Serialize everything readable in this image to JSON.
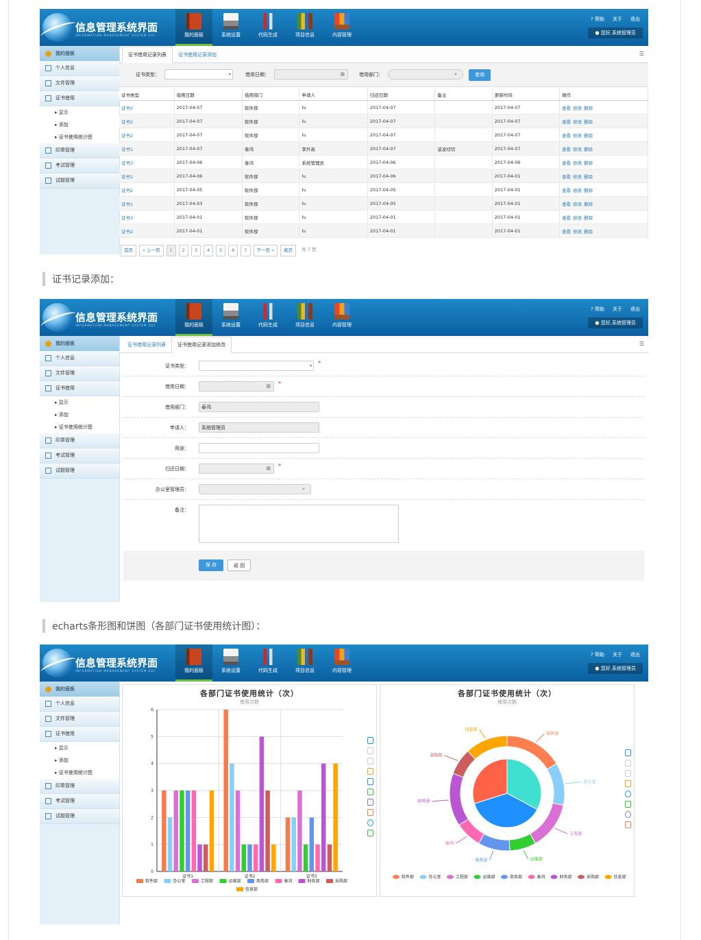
{
  "app": {
    "title": "信息管理系统界面",
    "subtitle": "INFORMATION MANAGEMENT SYSTEM GUI",
    "nav": [
      "我的面板",
      "系统设置",
      "代码生成",
      "项目信息",
      "内容管理"
    ],
    "top_links": [
      "帮助",
      "关于",
      "退出"
    ],
    "user": "您好,系统管理员"
  },
  "sidebar": {
    "head": "我的面板",
    "items": [
      "个人信息",
      "文件管理",
      "证书使用"
    ],
    "subs": [
      "显示",
      "添加",
      "证书使用统计图"
    ],
    "items2": [
      "印章管理",
      "考试管理",
      "试题管理"
    ]
  },
  "list_page": {
    "tabs": [
      "证书借用记录列表",
      "证书使用记录添加"
    ],
    "search": {
      "type_label": "证书类型：",
      "date_label": "借用日期：",
      "dept_label": "借用部门：",
      "button": "查询"
    },
    "columns": [
      "证书类型",
      "借用日期",
      "借用部门",
      "申请人",
      "归还日期",
      "备注",
      "更新时间",
      "操作"
    ],
    "rows": [
      [
        "证书2",
        "2017-04-07",
        "软件部",
        "lu",
        "2017-04-07",
        "",
        "2017-04-07"
      ],
      [
        "证书2",
        "2017-04-07",
        "软件部",
        "lu",
        "2017-04-07",
        "",
        "2017-04-07"
      ],
      [
        "证书2",
        "2017-04-07",
        "软件部",
        "lu",
        "2017-04-07",
        "",
        "2017-04-07"
      ],
      [
        "证书1",
        "2017-04-07",
        "泰鸿",
        "李升高",
        "2017-04-07",
        "凌凌切切",
        "2017-04-07"
      ],
      [
        "证书3",
        "2017-04-06",
        "泰鸿",
        "系统管理员",
        "2017-04-06",
        "",
        "2017-04-06"
      ],
      [
        "证书1",
        "2017-04-06",
        "软件部",
        "lu",
        "2017-04-06",
        "",
        "2017-04-01"
      ],
      [
        "证书2",
        "2017-04-05",
        "软件部",
        "lu",
        "2017-04-05",
        "",
        "2017-04-01"
      ],
      [
        "证书1",
        "2017-04-03",
        "软件部",
        "lu",
        "2017-04-05",
        "",
        "2017-04-01"
      ],
      [
        "证书3",
        "2017-04-01",
        "软件部",
        "lu",
        "2017-04-01",
        "",
        "2017-04-01"
      ],
      [
        "证书2",
        "2017-04-01",
        "软件部",
        "lu",
        "2017-04-01",
        "",
        "2017-04-01"
      ]
    ],
    "actions": [
      "查看",
      "修改",
      "删除"
    ],
    "pager": {
      "first": "首页",
      "prev": "« 上一页",
      "pages": [
        "1",
        "2",
        "3",
        "4",
        "5",
        "6",
        "7"
      ],
      "next": "下一页 »",
      "last": "尾页",
      "total": "共 7 页"
    }
  },
  "heading_add": "证书记录添加：",
  "add_page": {
    "tabs": [
      "证书借用记录列表",
      "证书使用记录添加修改"
    ],
    "fields": [
      "证书类型：",
      "借用日期：",
      "借用部门：",
      "申请人：",
      "用途：",
      "归还日期：",
      "办公室管理员：",
      "备注："
    ],
    "dept_value": "泰鸿",
    "applicant_value": "系统管理员",
    "save": "保 存",
    "back": "返 回"
  },
  "heading_chart": "echarts条形图和饼图（各部门证书使用统计图）：",
  "chart_data": [
    {
      "type": "bar",
      "title": "各部门证书使用统计（次）",
      "subtitle": "使用次数",
      "categories": [
        "证书1",
        "证书2",
        "证书3"
      ],
      "ylim": [
        0,
        6
      ],
      "yticks": [
        0,
        1,
        2,
        3,
        4,
        5,
        6
      ],
      "series": [
        {
          "name": "软件部",
          "color": "#f47c4e",
          "values": [
            3,
            6,
            2
          ]
        },
        {
          "name": "办公室",
          "color": "#87cefa",
          "values": [
            2,
            4,
            2
          ]
        },
        {
          "name": "工程部",
          "color": "#da70d6",
          "values": [
            3,
            3,
            3
          ]
        },
        {
          "name": "运维部",
          "color": "#32cd32",
          "values": [
            3,
            1,
            1
          ]
        },
        {
          "name": "商务部",
          "color": "#6495ed",
          "values": [
            3,
            1,
            2
          ]
        },
        {
          "name": "泰鸿",
          "color": "#ff69b4",
          "values": [
            3,
            1,
            1
          ]
        },
        {
          "name": "财务部",
          "color": "#ba55d3",
          "values": [
            1,
            5,
            4
          ]
        },
        {
          "name": "采购部",
          "color": "#cd5c5c",
          "values": [
            1,
            3,
            1
          ]
        },
        {
          "name": "信息部",
          "color": "#ffa500",
          "values": [
            3,
            1,
            4
          ]
        }
      ]
    },
    {
      "type": "pie",
      "title": "各部门证书使用统计（次）",
      "subtitle": "使用次数",
      "inner": [
        {
          "name": "证书1",
          "value": 22,
          "color": "#40e0d0"
        },
        {
          "name": "证书2",
          "value": 25,
          "color": "#1e90ff"
        },
        {
          "name": "证书3",
          "value": 20,
          "color": "#ff6347"
        }
      ],
      "outer": [
        {
          "name": "软件部",
          "value": 11,
          "color": "#ff7f50"
        },
        {
          "name": "办公室",
          "value": 8,
          "color": "#87cefa"
        },
        {
          "name": "工程部",
          "value": 9,
          "color": "#da70d6"
        },
        {
          "name": "运维部",
          "value": 5,
          "color": "#32cd32"
        },
        {
          "name": "商务部",
          "value": 6,
          "color": "#6495ed"
        },
        {
          "name": "泰鸿",
          "value": 5,
          "color": "#ff69b4"
        },
        {
          "name": "财务部",
          "value": 10,
          "color": "#ba55d3"
        },
        {
          "name": "采购部",
          "value": 5,
          "color": "#cd5c5c"
        },
        {
          "name": "信息部",
          "value": 8,
          "color": "#ffa500"
        }
      ]
    }
  ]
}
